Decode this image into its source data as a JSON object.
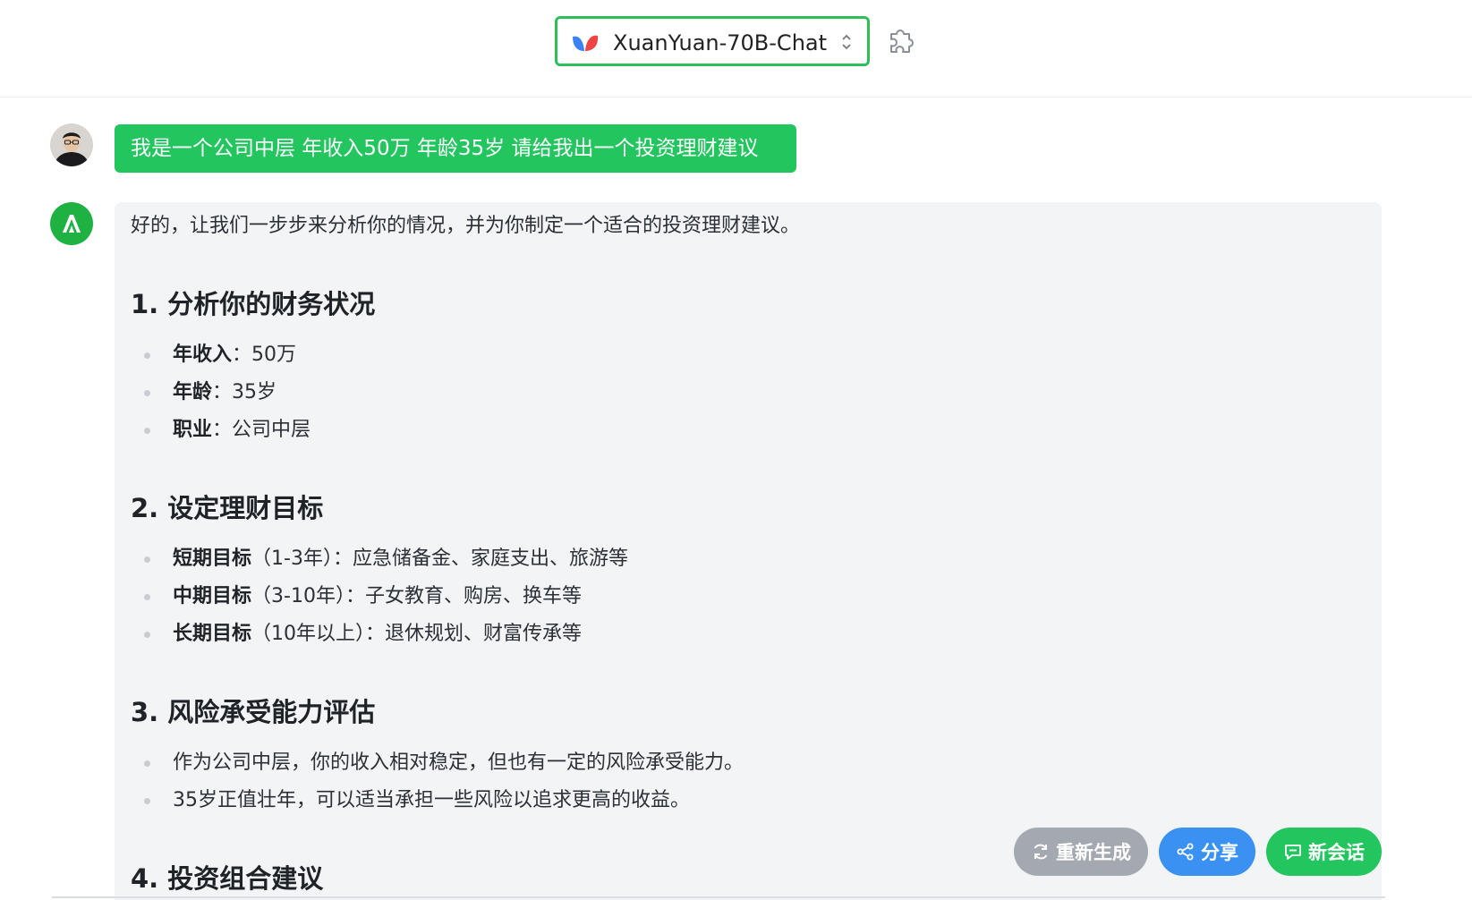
{
  "header": {
    "model_name": "XuanYuan-70B-Chat",
    "model_logo_icon": "butterfly-logo-icon",
    "chevron_icon": "select-chevrons-icon",
    "plugin_icon": "puzzle-icon",
    "accent_color": "#2fbf5a"
  },
  "conversation": {
    "user_message": "我是一个公司中层 年收入50万 年龄35岁 请给我出一个投资理财建议",
    "assistant": {
      "intro": "好的，让我们一步步来分析你的情况，并为你制定一个适合的投资理财建议。",
      "sections": [
        {
          "heading": "1. 分析你的财务状况",
          "items": [
            {
              "label": "年收入",
              "sep": "：",
              "text": "50万"
            },
            {
              "label": "年龄",
              "sep": "：",
              "text": "35岁"
            },
            {
              "label": "职业",
              "sep": "：",
              "text": "公司中层"
            }
          ]
        },
        {
          "heading": "2. 设定理财目标",
          "items": [
            {
              "label": "短期目标",
              "sep": "（1-3年）：",
              "text": "应急储备金、家庭支出、旅游等"
            },
            {
              "label": "中期目标",
              "sep": "（3-10年）：",
              "text": "子女教育、购房、换车等"
            },
            {
              "label": "长期目标",
              "sep": "（10年以上）：",
              "text": "退休规划、财富传承等"
            }
          ]
        },
        {
          "heading": "3. 风险承受能力评估",
          "items": [
            {
              "label": "",
              "sep": "",
              "text": "作为公司中层，你的收入相对稳定，但也有一定的风险承受能力。"
            },
            {
              "label": "",
              "sep": "",
              "text": "35岁正值壮年，可以适当承担一些风险以追求更高的收益。"
            }
          ]
        },
        {
          "heading": "4. 投资组合建议",
          "items": []
        }
      ]
    }
  },
  "actions": {
    "regenerate_label": "重新生成",
    "share_label": "分享",
    "new_chat_label": "新会话",
    "regenerate_color": "#a3a8b1",
    "share_color": "#3b91f2",
    "new_chat_color": "#22c55e"
  }
}
